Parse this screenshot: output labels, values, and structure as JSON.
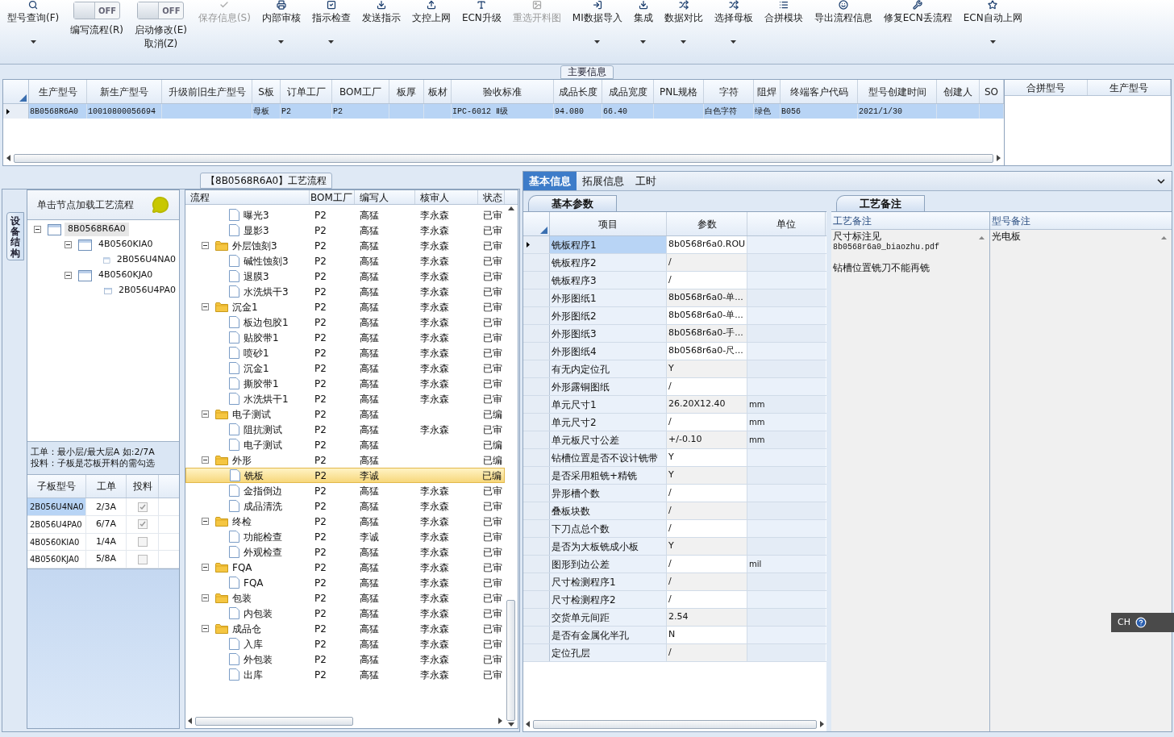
{
  "toolbar": [
    {
      "kind": "button",
      "label": "型号查询(F)",
      "disabled": false,
      "dropdown": true
    },
    {
      "kind": "toggle",
      "state_label": "OFF",
      "on": false,
      "label": "编写流程(R)"
    },
    {
      "kind": "toggle",
      "state_label": "OFF",
      "on": false,
      "label": "启动修改(E)",
      "sublabel": "取消(Z)"
    },
    {
      "kind": "button",
      "label": "保存信息(S)",
      "disabled": true,
      "dropdown": false
    },
    {
      "kind": "button",
      "label": "内部审核",
      "disabled": false,
      "dropdown": true
    },
    {
      "kind": "button",
      "label": "指示检查",
      "disabled": false,
      "dropdown": true
    },
    {
      "kind": "button",
      "label": "发送指示",
      "disabled": false,
      "dropdown": false
    },
    {
      "kind": "button",
      "label": "文控上网",
      "disabled": false,
      "dropdown": false
    },
    {
      "kind": "button",
      "label": "ECN升级",
      "disabled": false,
      "dropdown": false
    },
    {
      "kind": "button",
      "label": "重选开料图",
      "disabled": true,
      "dropdown": false
    },
    {
      "kind": "button",
      "label": "MI数据导入",
      "disabled": false,
      "dropdown": true
    },
    {
      "kind": "button",
      "label": "集成",
      "disabled": false,
      "dropdown": true
    },
    {
      "kind": "button",
      "label": "数据对比",
      "disabled": false,
      "dropdown": true
    },
    {
      "kind": "button",
      "label": "选择母板",
      "disabled": false,
      "dropdown": true
    },
    {
      "kind": "button",
      "label": "合拼模块",
      "disabled": false,
      "dropdown": false
    },
    {
      "kind": "button",
      "label": "导出流程信息",
      "disabled": false,
      "dropdown": false
    },
    {
      "kind": "button",
      "label": "修复ECN丢流程",
      "disabled": false,
      "dropdown": false
    },
    {
      "kind": "button",
      "label": "ECN自动上网",
      "disabled": false,
      "dropdown": true
    }
  ],
  "main_info": {
    "title": "主要信息",
    "columns": [
      "生产型号",
      "新生产型号",
      "升级前旧生产型号",
      "S板",
      "订单工厂",
      "BOM工厂",
      "板厚",
      "板材",
      "验收标准",
      "成品长度",
      "成品宽度",
      "PNL规格",
      "字符",
      "阻焊",
      "终端客户代码",
      "型号创建时间",
      "创建人",
      "SO"
    ],
    "rows": [
      {
        "selected": true,
        "cells": [
          "8B0568R6A0",
          "10010800056694",
          null,
          "母板",
          "P2",
          "P2",
          null,
          null,
          "IPC-6012 Ⅱ级",
          "94.080",
          "66.40",
          null,
          "白色字符",
          "绿色",
          "B056",
          "2021/1/30",
          null,
          null
        ]
      }
    ],
    "merge_table": {
      "columns": [
        "合拼型号",
        "生产型号"
      ]
    }
  },
  "process": {
    "title": "【8B0568R6A0】工艺流程",
    "side_tab": "设备结构",
    "hint": "单击节点加载工艺流程",
    "board_tree": [
      {
        "label": "8B0568R6A0",
        "selected": true,
        "expanded": true,
        "children": [
          {
            "label": "4B0560KIA0",
            "selected": false,
            "expanded": true,
            "children": [
              {
                "label": "2B056U4NA0",
                "selected": false
              }
            ]
          },
          {
            "label": "4B0560KJA0",
            "selected": false,
            "expanded": true,
            "children": [
              {
                "label": "2B056U4PA0",
                "selected": false
              }
            ]
          }
        ]
      }
    ],
    "note_lines": [
      "工单：最小层/最大层A 如:2/7A",
      "投料：子板是芯板开料的需勾选"
    ],
    "sub_boards": {
      "columns": [
        "子板型号",
        "工单",
        "投料"
      ],
      "rows": [
        {
          "model": "2B056U4NA0",
          "order": "2/3A",
          "feed": true,
          "selected": true
        },
        {
          "model": "2B056U4PA0",
          "order": "6/7A",
          "feed": true,
          "selected": false
        },
        {
          "model": "4B0560KIA0",
          "order": "1/4A",
          "feed": false,
          "selected": false
        },
        {
          "model": "4B0560KJA0",
          "order": "5/8A",
          "feed": false,
          "selected": false
        }
      ]
    },
    "flow": {
      "columns": [
        "流程",
        "BOM工厂",
        "编写人",
        "核审人",
        "状态"
      ],
      "rows": [
        {
          "kind": "file",
          "name": "曝光3",
          "factory": "P2",
          "writer": "高猛",
          "reviewer": "李永森",
          "status": "已审",
          "selected": false
        },
        {
          "kind": "file",
          "name": "显影3",
          "factory": "P2",
          "writer": "高猛",
          "reviewer": "李永森",
          "status": "已审",
          "selected": false
        },
        {
          "kind": "folder",
          "name": "外层蚀刻3",
          "factory": "P2",
          "writer": "高猛",
          "reviewer": "李永森",
          "status": "已审",
          "selected": false,
          "expanded": true,
          "children": [
            {
              "kind": "file",
              "name": "碱性蚀刻3",
              "factory": "P2",
              "writer": "高猛",
              "reviewer": "李永森",
              "status": "已审",
              "selected": false
            },
            {
              "kind": "file",
              "name": "退膜3",
              "factory": "P2",
              "writer": "高猛",
              "reviewer": "李永森",
              "status": "已审",
              "selected": false
            },
            {
              "kind": "file",
              "name": "水洗烘干3",
              "factory": "P2",
              "writer": "高猛",
              "reviewer": "李永森",
              "status": "已审",
              "selected": false
            }
          ]
        },
        {
          "kind": "folder",
          "name": "沉金1",
          "factory": "P2",
          "writer": "高猛",
          "reviewer": "李永森",
          "status": "已审",
          "selected": false,
          "expanded": true,
          "children": [
            {
              "kind": "file",
              "name": "板边包胶1",
              "factory": "P2",
              "writer": "高猛",
              "reviewer": "李永森",
              "status": "已审",
              "selected": false
            },
            {
              "kind": "file",
              "name": "贴胶带1",
              "factory": "P2",
              "writer": "高猛",
              "reviewer": "李永森",
              "status": "已审",
              "selected": false
            },
            {
              "kind": "file",
              "name": "喷砂1",
              "factory": "P2",
              "writer": "高猛",
              "reviewer": "李永森",
              "status": "已审",
              "selected": false
            },
            {
              "kind": "file",
              "name": "沉金1",
              "factory": "P2",
              "writer": "高猛",
              "reviewer": "李永森",
              "status": "已审",
              "selected": false
            },
            {
              "kind": "file",
              "name": "撕胶带1",
              "factory": "P2",
              "writer": "高猛",
              "reviewer": "李永森",
              "status": "已审",
              "selected": false
            },
            {
              "kind": "file",
              "name": "水洗烘干1",
              "factory": "P2",
              "writer": "高猛",
              "reviewer": "李永森",
              "status": "已审",
              "selected": false
            }
          ]
        },
        {
          "kind": "folder",
          "name": "电子测试",
          "factory": "P2",
          "writer": "高猛",
          "status": "已编",
          "selected": false,
          "expanded": true,
          "children": [
            {
              "kind": "file",
              "name": "阻抗测试",
              "factory": "P2",
              "writer": "高猛",
              "reviewer": "李永森",
              "status": "已审",
              "selected": false
            },
            {
              "kind": "file",
              "name": "电子测试",
              "factory": "P2",
              "writer": "高猛",
              "status": "已编",
              "selected": false
            }
          ]
        },
        {
          "kind": "folder",
          "name": "外形",
          "factory": "P2",
          "writer": "高猛",
          "status": "已编",
          "selected": false,
          "expanded": true,
          "children": [
            {
              "kind": "file",
              "name": "铣板",
              "factory": "P2",
              "writer": "李诚",
              "status": "已编",
              "selected": true
            },
            {
              "kind": "file",
              "name": "金指倒边",
              "factory": "P2",
              "writer": "高猛",
              "reviewer": "李永森",
              "status": "已审",
              "selected": false
            },
            {
              "kind": "file",
              "name": "成品清洗",
              "factory": "P2",
              "writer": "高猛",
              "reviewer": "李永森",
              "status": "已审",
              "selected": false
            }
          ]
        },
        {
          "kind": "folder",
          "name": "终检",
          "factory": "P2",
          "writer": "高猛",
          "reviewer": "李永森",
          "status": "已审",
          "selected": false,
          "expanded": true,
          "children": [
            {
              "kind": "file",
              "name": "功能检查",
              "factory": "P2",
              "writer": "李诚",
              "reviewer": "李永森",
              "status": "已审",
              "selected": false
            },
            {
              "kind": "file",
              "name": "外观检查",
              "factory": "P2",
              "writer": "高猛",
              "reviewer": "李永森",
              "status": "已审",
              "selected": false
            }
          ]
        },
        {
          "kind": "folder",
          "name": "FQA",
          "factory": "P2",
          "writer": "高猛",
          "reviewer": "李永森",
          "status": "已审",
          "selected": false,
          "expanded": true,
          "children": [
            {
              "kind": "file",
              "name": "FQA",
              "factory": "P2",
              "writer": "高猛",
              "reviewer": "李永森",
              "status": "已审",
              "selected": false
            }
          ]
        },
        {
          "kind": "folder",
          "name": "包装",
          "factory": "P2",
          "writer": "高猛",
          "reviewer": "李永森",
          "status": "已审",
          "selected": false,
          "expanded": true,
          "children": [
            {
              "kind": "file",
              "name": "内包装",
              "factory": "P2",
              "writer": "高猛",
              "reviewer": "李永森",
              "status": "已审",
              "selected": false
            }
          ]
        },
        {
          "kind": "folder",
          "name": "成品仓",
          "factory": "P2",
          "writer": "高猛",
          "reviewer": "李永森",
          "status": "已审",
          "selected": false,
          "expanded": true,
          "children": [
            {
              "kind": "file",
              "name": "入库",
              "factory": "P2",
              "writer": "高猛",
              "reviewer": "李永森",
              "status": "已审",
              "selected": false
            },
            {
              "kind": "file",
              "name": "外包装",
              "factory": "P2",
              "writer": "高猛",
              "reviewer": "李永森",
              "status": "已审",
              "selected": false
            },
            {
              "kind": "file",
              "name": "出库",
              "factory": "P2",
              "writer": "高猛",
              "reviewer": "李永森",
              "status": "已审",
              "selected": false
            }
          ]
        }
      ]
    }
  },
  "details": {
    "tabs": [
      {
        "label": "基本信息",
        "selected": true
      },
      {
        "label": "拓展信息",
        "selected": false
      },
      {
        "label": "工时",
        "selected": false
      }
    ],
    "params_tab": "基本参数",
    "params": {
      "columns": [
        "项目",
        "参数",
        "单位"
      ],
      "rows": [
        {
          "item": "铣板程序1",
          "value": "8b0568r6a0.ROU",
          "selected": true
        },
        {
          "item": "铣板程序2",
          "value": "/",
          "selected": false
        },
        {
          "item": "铣板程序3",
          "value": "/",
          "selected": false
        },
        {
          "item": "外形图纸1",
          "value": "8b0568r6a0-单...",
          "selected": false
        },
        {
          "item": "外形图纸2",
          "value": "8b0568r6a0-单...",
          "selected": false
        },
        {
          "item": "外形图纸3",
          "value": "8b0568r6a0-手...",
          "selected": false
        },
        {
          "item": "外形图纸4",
          "value": "8b0568r6a0-尺...",
          "selected": false
        },
        {
          "item": "有无内定位孔",
          "value": "Y",
          "selected": false
        },
        {
          "item": "外形露铜图纸",
          "value": "/",
          "selected": false
        },
        {
          "item": "单元尺寸1",
          "value": "26.20X12.40",
          "unit": "mm",
          "selected": false
        },
        {
          "item": "单元尺寸2",
          "value": "/",
          "unit": "mm",
          "selected": false
        },
        {
          "item": "单元板尺寸公差",
          "value": "+/-0.10",
          "unit": "mm",
          "selected": false
        },
        {
          "item": "钻槽位置是否不设计铣带",
          "value": "Y",
          "selected": false
        },
        {
          "item": "是否采用粗铣+精铣",
          "value": "Y",
          "selected": false
        },
        {
          "item": "异形槽个数",
          "value": "/",
          "selected": false
        },
        {
          "item": "叠板块数",
          "value": "/",
          "selected": false
        },
        {
          "item": "下刀点总个数",
          "value": "/",
          "selected": false
        },
        {
          "item": "是否为大板铣成小板",
          "value": "Y",
          "selected": false
        },
        {
          "item": "图形到边公差",
          "value": "/",
          "unit": "mil",
          "selected": false
        },
        {
          "item": "尺寸检测程序1",
          "value": "/",
          "selected": false
        },
        {
          "item": "尺寸检测程序2",
          "value": "/",
          "selected": false
        },
        {
          "item": "交货单元间距",
          "value": "2.54",
          "selected": false
        },
        {
          "item": "是否有金属化半孔",
          "value": "N",
          "selected": false
        },
        {
          "item": "定位孔层",
          "value": "/",
          "selected": false
        }
      ]
    },
    "remarks_tab": "工艺备注",
    "remarks": {
      "columns": [
        "工艺备注",
        "型号备注"
      ],
      "process_note": [
        {
          "lines": [
            "尺寸标注见",
            "8b0568r6a0_biaozhu.pdf"
          ]
        },
        {
          "lines": [
            "钻槽位置铣刀不能再铣"
          ]
        }
      ],
      "model_note": "光电板"
    }
  },
  "language_bar": {
    "text": "CH"
  }
}
